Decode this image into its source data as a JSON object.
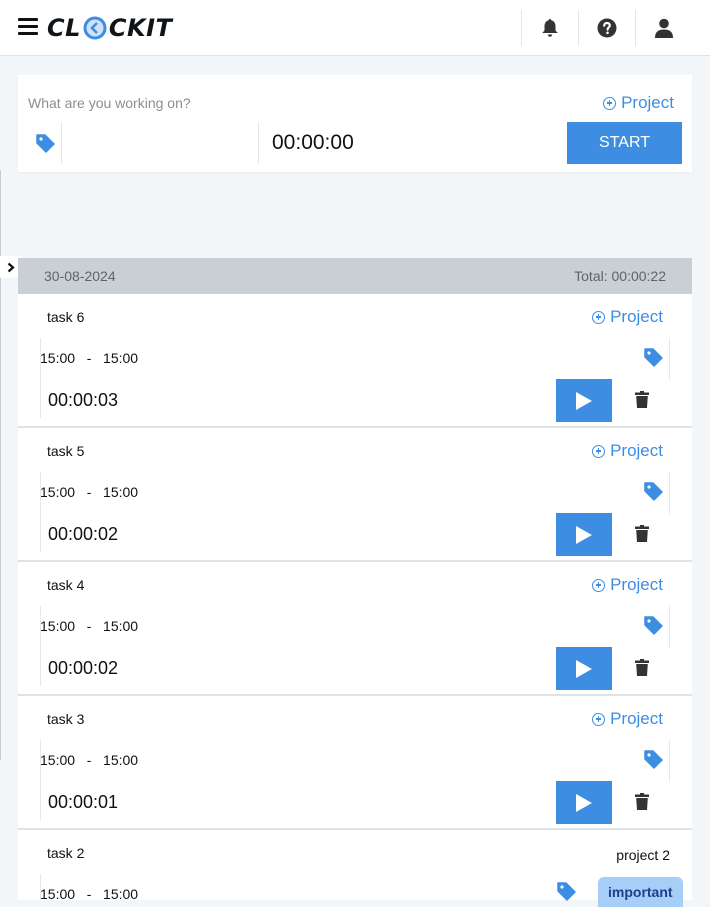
{
  "header": {
    "logo_text_left": "CL",
    "logo_text_right": "CKIT",
    "icons": [
      "menu-icon",
      "bell-icon",
      "help-icon",
      "user-icon"
    ]
  },
  "tracker": {
    "placeholder": "What are you working on?",
    "project_label": "Project",
    "timer": "00:00:00",
    "start_label": "START"
  },
  "day": {
    "date": "30-08-2024",
    "total": "Total: 00:00:22"
  },
  "entries": [
    {
      "description": "task 6",
      "project": "Project",
      "start": "15:00",
      "end": "15:00",
      "duration": "00:00:03"
    },
    {
      "description": "task 5",
      "project": "Project",
      "start": "15:00",
      "end": "15:00",
      "duration": "00:00:02"
    },
    {
      "description": "task 4",
      "project": "Project",
      "start": "15:00",
      "end": "15:00",
      "duration": "00:00:02"
    },
    {
      "description": "task 3",
      "project": "Project",
      "start": "15:00",
      "end": "15:00",
      "duration": "00:00:01"
    },
    {
      "description": "task 2",
      "project": "project 2",
      "start": "15:00",
      "end": "15:00",
      "tag": "important"
    }
  ],
  "colors": {
    "accent": "#3d8de3",
    "day_header": "#c9cfd4",
    "tag_badge": "#a7cef7",
    "page_bg": "#f2f6f8"
  }
}
